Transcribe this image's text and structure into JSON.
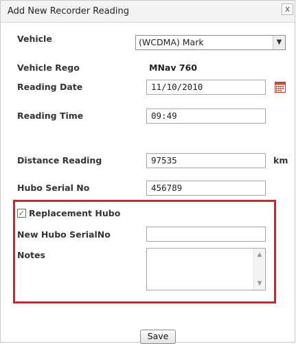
{
  "dialog": {
    "title": "Add New Recorder Reading",
    "close_label": "x"
  },
  "form": {
    "vehicle": {
      "label": "Vehicle",
      "selected": "(WCDMA) Mark"
    },
    "vehicle_rego": {
      "label": "Vehicle Rego",
      "value": "MNav 760"
    },
    "reading_date": {
      "label": "Reading Date",
      "value": "11/10/2010"
    },
    "reading_time": {
      "label": "Reading Time",
      "value": "09:49"
    },
    "distance_reading": {
      "label": "Distance Reading",
      "value": "97535",
      "unit": "km"
    },
    "hubo_serial": {
      "label": "Hubo Serial No",
      "value": "456789"
    },
    "replacement_hubo": {
      "label": "Replacement Hubo",
      "checked": true
    },
    "new_hubo_serial": {
      "label": "New Hubo SerialNo",
      "value": ""
    },
    "notes": {
      "label": "Notes",
      "value": ""
    }
  },
  "actions": {
    "save_label": "Save"
  },
  "icons": [
    "close-icon",
    "calendar-icon",
    "checkmark-icon",
    "chevron-down-icon",
    "scroll-up-icon",
    "scroll-down-icon"
  ],
  "colors": {
    "highlight": "#e21c21",
    "titlebar": "#f3f3f3"
  }
}
